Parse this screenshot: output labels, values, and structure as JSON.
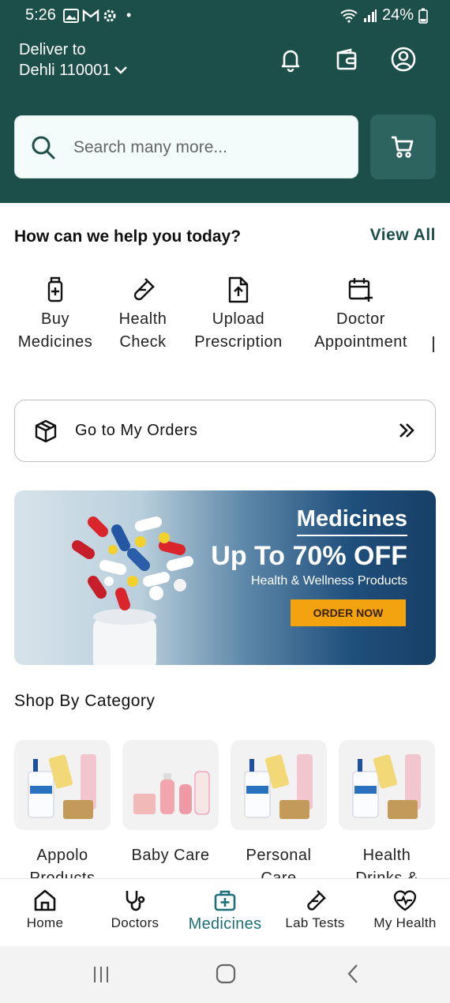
{
  "status_bar": {
    "time": "5:26",
    "battery": "24%"
  },
  "header": {
    "deliver_label": "Deliver to",
    "location": "Dehli 110001",
    "search_placeholder": "Search many more...",
    "colors": {
      "primary": "#1d4f4a"
    }
  },
  "help": {
    "title": "How can we help you today?",
    "view_all": "View All",
    "services": [
      {
        "line1": "Buy",
        "line2": "Medicines",
        "icon": "medicine-bottle-icon"
      },
      {
        "line1": "Health",
        "line2": "Check",
        "icon": "test-tube-icon"
      },
      {
        "line1": "Upload",
        "line2": "Prescription",
        "icon": "upload-file-icon"
      },
      {
        "line1": "Doctor",
        "line2": "Appointment",
        "icon": "calendar-plus-icon"
      }
    ]
  },
  "orders": {
    "label": "Go to My Orders"
  },
  "banner": {
    "title": "Medicines",
    "offer": "Up To 70% OFF",
    "subtitle": "Health & Wellness Products",
    "button": "ORDER NOW"
  },
  "categories": {
    "title": "Shop By Category",
    "items": [
      {
        "name": "Appolo Products"
      },
      {
        "name": "Baby Care"
      },
      {
        "name": "Personal Care"
      },
      {
        "name": "Health Drinks &"
      }
    ]
  },
  "bottom_nav": {
    "items": [
      {
        "label": "Home",
        "icon": "home-icon"
      },
      {
        "label": "Doctors",
        "icon": "stethoscope-icon"
      },
      {
        "label": "Medicines",
        "icon": "medical-bag-icon",
        "active": true
      },
      {
        "label": "Lab Tests",
        "icon": "test-tube-icon"
      },
      {
        "label": "My Health",
        "icon": "heart-pulse-icon"
      }
    ]
  }
}
